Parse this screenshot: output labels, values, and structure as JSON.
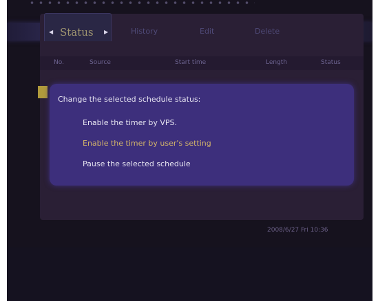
{
  "tabs": [
    {
      "label": "Status",
      "active": true
    },
    {
      "label": "History",
      "active": false
    },
    {
      "label": "Edit",
      "active": false
    },
    {
      "label": "Delete",
      "active": false
    }
  ],
  "columns": [
    "No.",
    "Source",
    "Start time",
    "Length",
    "Status"
  ],
  "dialog": {
    "title": "Change the selected schedule status:",
    "options": [
      "Enable the timer by VPS.",
      "Enable the timer by user's setting",
      "Pause the selected schedule"
    ],
    "selected_index": 1
  },
  "datetime": "2008/6/27 Fri 10:36",
  "colors": {
    "dialog_bg": "#3d2f7c",
    "selected_option": "#d3b46a",
    "panel_bg": "#2a1f35"
  }
}
